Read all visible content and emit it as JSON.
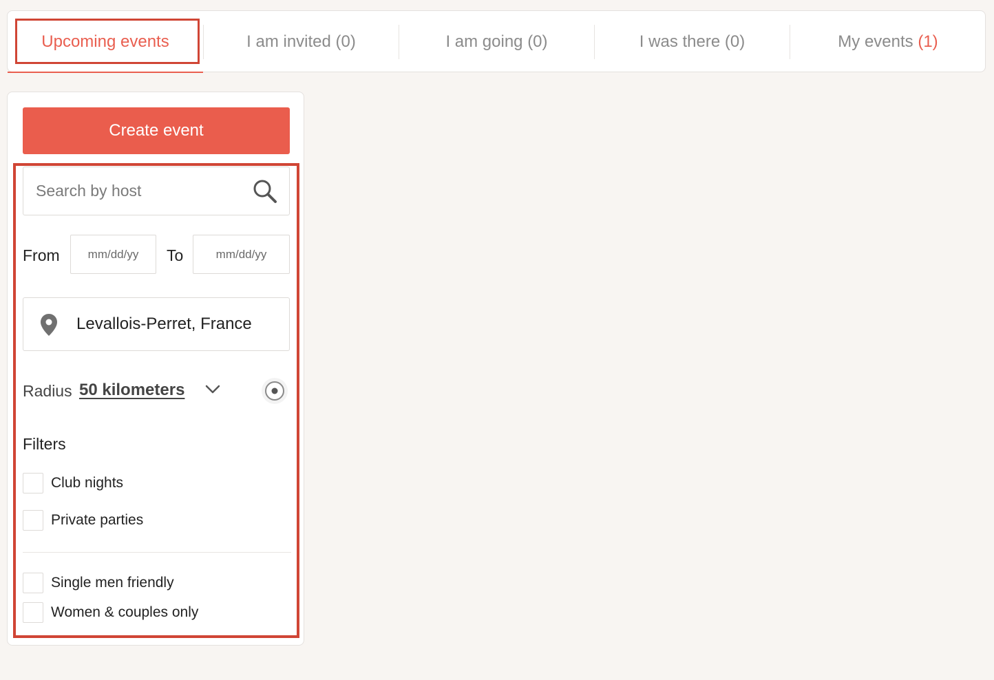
{
  "tabs": [
    {
      "label": "Upcoming events",
      "count": ""
    },
    {
      "label": "I am invited (0)",
      "count": ""
    },
    {
      "label": "I am going (0)",
      "count": ""
    },
    {
      "label": "I was there (0)",
      "count": ""
    },
    {
      "label": "My events",
      "count": "(1)"
    }
  ],
  "sidebar": {
    "create_button": "Create event",
    "search": {
      "placeholder": "Search by host",
      "value": ""
    },
    "date": {
      "from_label": "From",
      "to_label": "To",
      "from_placeholder": "mm/dd/yy",
      "to_placeholder": "mm/dd/yy"
    },
    "location": "Levallois-Perret, France",
    "radius": {
      "label": "Radius",
      "value": "50 kilometers"
    },
    "filters": {
      "title": "Filters",
      "group1": [
        "Club nights",
        "Private parties"
      ],
      "group2": [
        "Single men friendly",
        "Women & couples only"
      ]
    }
  },
  "icons": {
    "search": "search-icon",
    "location": "map-pin-icon",
    "dropdown": "chevron-down-icon",
    "locate": "locate-me-icon"
  },
  "colors": {
    "accent": "#ea5d4d",
    "highlight": "#d04535",
    "background": "#f8f5f2"
  }
}
